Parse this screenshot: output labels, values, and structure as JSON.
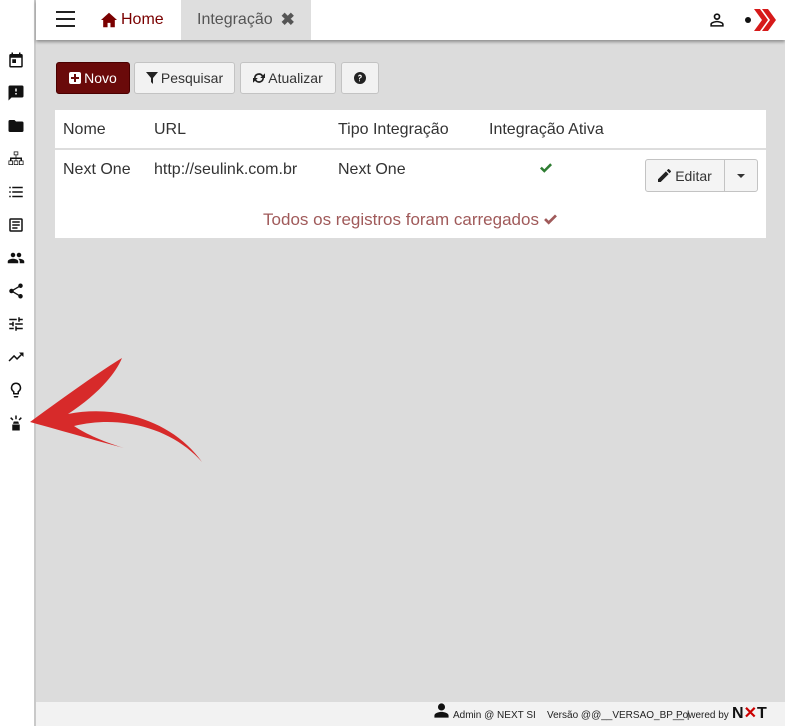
{
  "sidebar": {
    "items": [
      {
        "icon": "calendar-icon"
      },
      {
        "icon": "feedback-icon"
      },
      {
        "icon": "folder-icon"
      },
      {
        "icon": "sitemap-icon"
      },
      {
        "icon": "list-icon"
      },
      {
        "icon": "article-icon"
      },
      {
        "icon": "people-icon"
      },
      {
        "icon": "share-icon"
      },
      {
        "icon": "tune-icon"
      },
      {
        "icon": "trending-icon"
      },
      {
        "icon": "lightbulb-icon"
      },
      {
        "icon": "integration-icon"
      }
    ]
  },
  "topbar": {
    "home_tab": "Home",
    "active_tab": "Integração",
    "close_symbol": "✖"
  },
  "toolbar": {
    "new_label": "Novo",
    "search_label": "Pesquisar",
    "refresh_label": "Atualizar"
  },
  "table": {
    "columns": [
      "Nome",
      "URL",
      "Tipo Integração",
      "Integração Ativa"
    ],
    "rows": [
      {
        "nome": "Next One",
        "url": "http://seulink.com.br",
        "tipo": "Next One",
        "ativa": true,
        "edit_label": "Editar"
      }
    ],
    "loaded_message": "Todos os registros foram carregados"
  },
  "footer": {
    "user": "Admin @ NEXT SI",
    "version": "Versão @@__VERSAO_BP__ |",
    "powered": "Powered by",
    "brand": "NXT"
  },
  "colors": {
    "brand_dark_red": "#6a0a0a",
    "home_red": "#7a0000",
    "check_green": "#2e7d32",
    "loaded_text": "#a05a5a",
    "annotation_arrow": "#d61a1a"
  }
}
